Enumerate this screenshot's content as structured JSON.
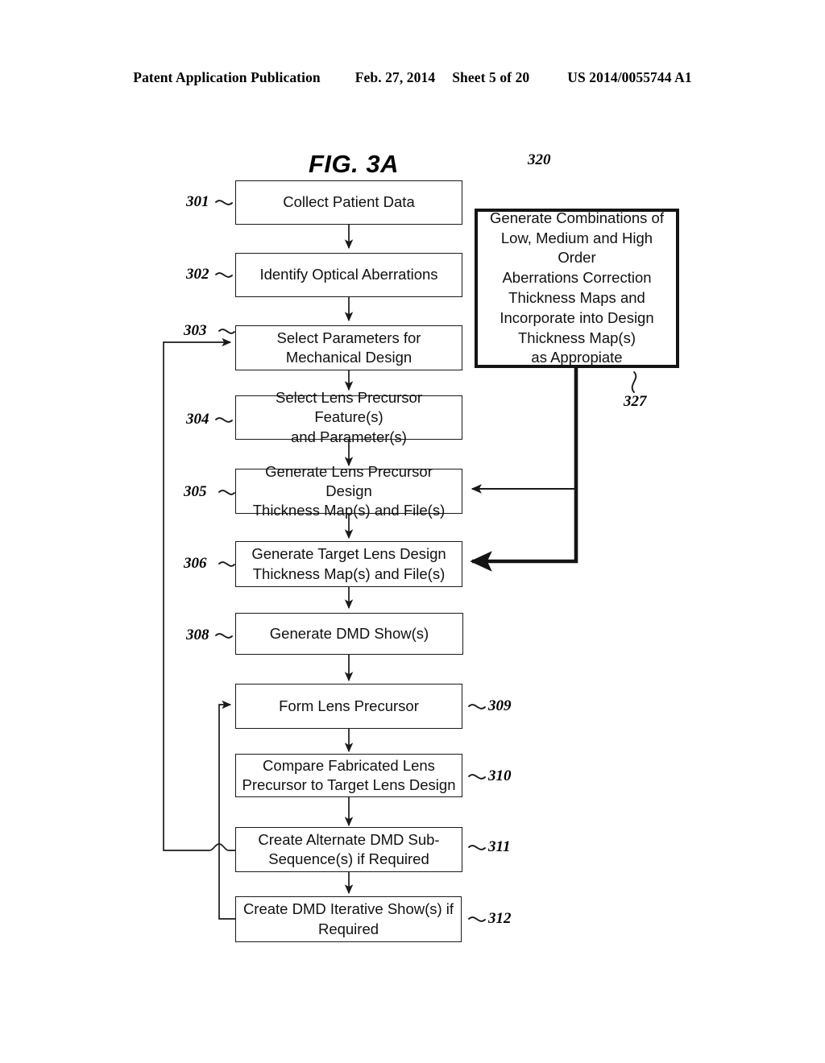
{
  "header": {
    "publication": "Patent Application Publication",
    "date": "Feb. 27, 2014",
    "sheet": "Sheet 5 of 20",
    "docket": "US 2014/0055744 A1"
  },
  "figure": {
    "title": "FIG. 3A",
    "diagram_label": "320",
    "type": "flowchart",
    "nodes": [
      {
        "ref": "301",
        "label": "Collect Patient Data"
      },
      {
        "ref": "302",
        "label": "Identify Optical Aberrations"
      },
      {
        "ref": "303",
        "label": "Select Parameters for Mechanical Design"
      },
      {
        "ref": "304",
        "label": "Select Lens Precursor Feature(s) and Parameter(s)"
      },
      {
        "ref": "305",
        "label": "Generate Lens Precursor Design Thickness Map(s) and File(s)"
      },
      {
        "ref": "306",
        "label": "Generate Target Lens Design Thickness Map(s) and File(s)"
      },
      {
        "ref": "308",
        "label": "Generate DMD Show(s)"
      },
      {
        "ref": "309",
        "label": "Form Lens Precursor"
      },
      {
        "ref": "310",
        "label": "Compare Fabricated Lens Precursor to Target Lens Design"
      },
      {
        "ref": "311",
        "label": "Create Alternate DMD Sub-Sequence(s) if Required"
      },
      {
        "ref": "312",
        "label": "Create DMD Iterative Show(s) if Required"
      },
      {
        "ref": "327",
        "label": "Generate Combinations of Low, Medium and High Order Aberrations Correction Thickness Maps and Incorporate into Design Thickness Map(s) as Appropiate"
      }
    ],
    "node_lines": {
      "n301": [
        "Collect Patient Data"
      ],
      "n302": [
        "Identify Optical Aberrations"
      ],
      "n303": [
        "Select Parameters for",
        "Mechanical Design"
      ],
      "n304": [
        "Select Lens Precursor Feature(s)",
        "and Parameter(s)"
      ],
      "n305": [
        "Generate Lens Precursor Design",
        "Thickness Map(s) and File(s)"
      ],
      "n306": [
        "Generate Target Lens Design",
        "Thickness Map(s) and File(s)"
      ],
      "n308": [
        "Generate DMD Show(s)"
      ],
      "n309": [
        "Form Lens Precursor"
      ],
      "n310": [
        "Compare Fabricated Lens",
        "Precursor to Target Lens Design"
      ],
      "n311": [
        "Create Alternate DMD Sub-",
        "Sequence(s) if Required"
      ],
      "n312": [
        "Create DMD Iterative Show(s) if",
        "Required"
      ],
      "n327": [
        "Generate Combinations of",
        "Low, Medium and High Order",
        "Aberrations Correction",
        "Thickness Maps and",
        "Incorporate into Design",
        "Thickness Map(s)",
        "as Appropiate"
      ]
    },
    "refs": {
      "r301": "301",
      "r302": "302",
      "r303": "303",
      "r304": "304",
      "r305": "305",
      "r306": "306",
      "r308": "308",
      "r309": "309",
      "r310": "310",
      "r311": "311",
      "r312": "312",
      "r320": "320",
      "r327": "327"
    },
    "colors": {
      "ink": "#111111",
      "page": "#ffffff",
      "emphasis_border": "#141414"
    }
  }
}
